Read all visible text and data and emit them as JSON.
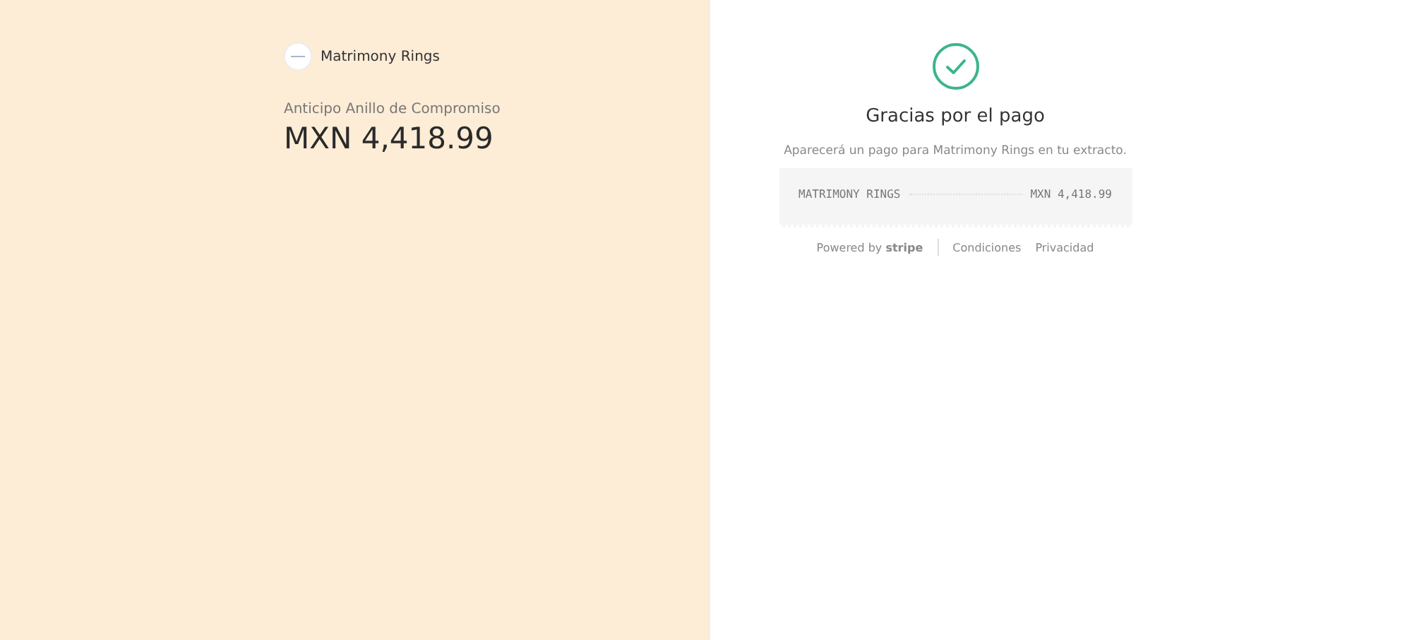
{
  "merchant": {
    "name": "Matrimony Rings"
  },
  "product": {
    "name": "Anticipo Anillo de Compromiso",
    "amount": "MXN 4,418.99"
  },
  "confirmation": {
    "title": "Gracias por el pago",
    "message": "Aparecerá un pago para Matrimony Rings en tu extracto."
  },
  "receipt": {
    "descriptor": "MATRIMONY RINGS",
    "amount": "MXN 4,418.99"
  },
  "footer": {
    "powered_by": "Powered by **stripe**",
    "links": [
      "Condiciones",
      "Privacidad"
    ]
  }
}
